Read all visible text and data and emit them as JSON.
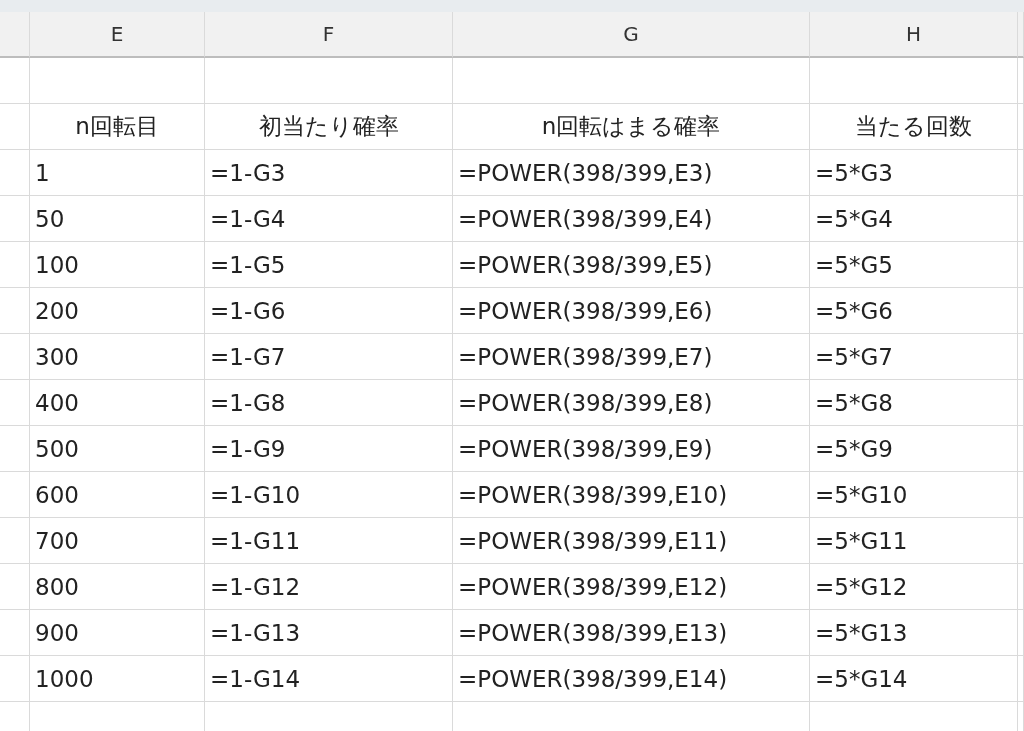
{
  "column_headers": [
    "E",
    "F",
    "G",
    "H"
  ],
  "table": {
    "header": [
      "n回転目",
      "初当たり確率",
      "n回転はまる確率",
      "当たる回数"
    ],
    "rows": [
      [
        "1",
        "=1-G3",
        "=POWER(398/399,E3)",
        "=5*G3"
      ],
      [
        "50",
        "=1-G4",
        "=POWER(398/399,E4)",
        "=5*G4"
      ],
      [
        "100",
        "=1-G5",
        "=POWER(398/399,E5)",
        "=5*G5"
      ],
      [
        "200",
        "=1-G6",
        "=POWER(398/399,E6)",
        "=5*G6"
      ],
      [
        "300",
        "=1-G7",
        "=POWER(398/399,E7)",
        "=5*G7"
      ],
      [
        "400",
        "=1-G8",
        "=POWER(398/399,E8)",
        "=5*G8"
      ],
      [
        "500",
        "=1-G9",
        "=POWER(398/399,E9)",
        "=5*G9"
      ],
      [
        "600",
        "=1-G10",
        "=POWER(398/399,E10)",
        "=5*G10"
      ],
      [
        "700",
        "=1-G11",
        "=POWER(398/399,E11)",
        "=5*G11"
      ],
      [
        "800",
        "=1-G12",
        "=POWER(398/399,E12)",
        "=5*G12"
      ],
      [
        "900",
        "=1-G13",
        "=POWER(398/399,E13)",
        "=5*G13"
      ],
      [
        "1000",
        "=1-G14",
        "=POWER(398/399,E14)",
        "=5*G14"
      ]
    ]
  }
}
